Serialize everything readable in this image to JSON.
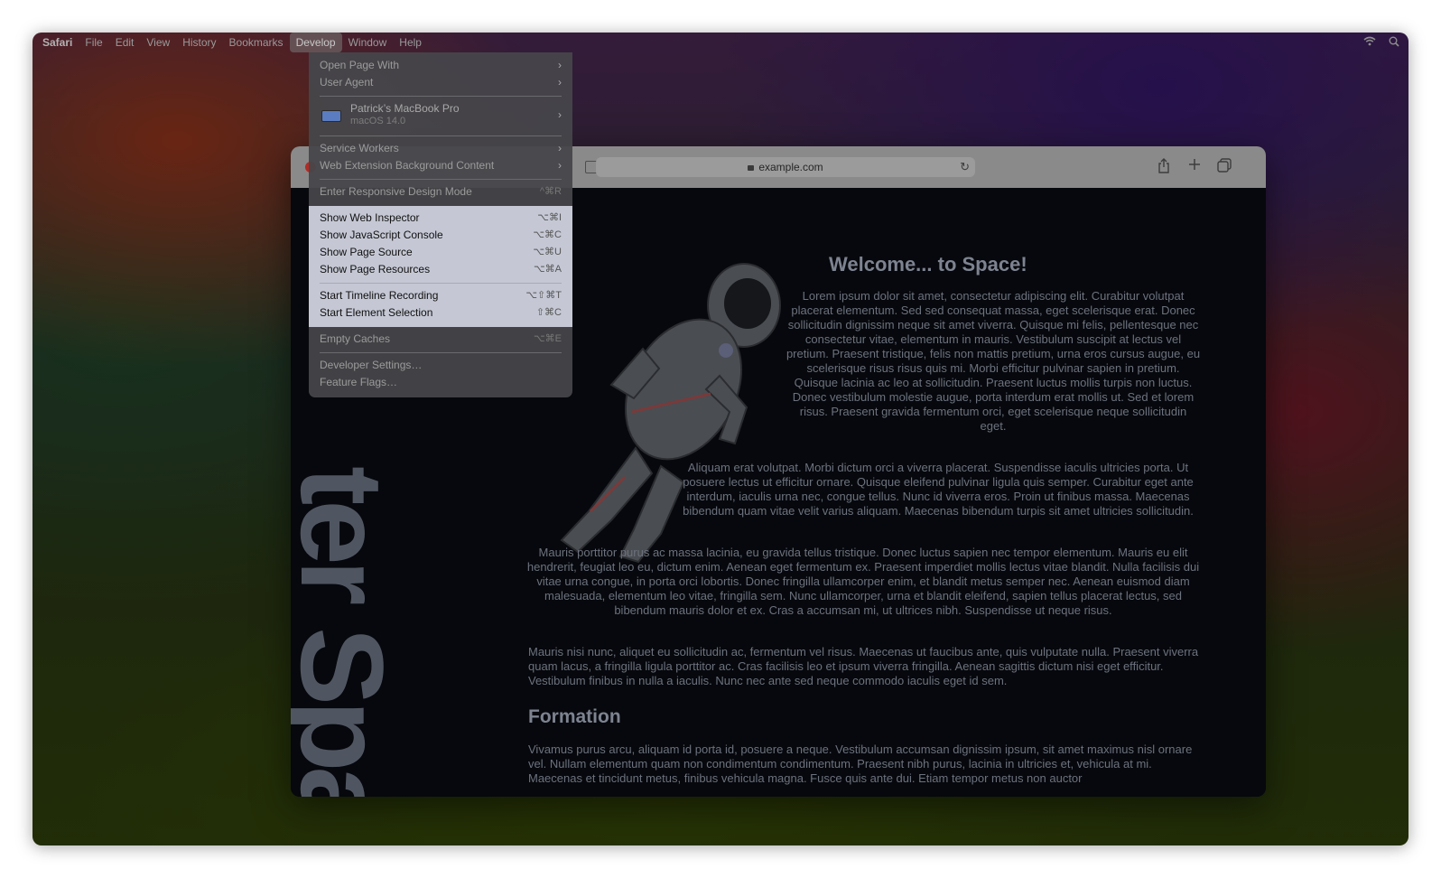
{
  "menubar": {
    "app": "Safari",
    "items": [
      "File",
      "Edit",
      "View",
      "History",
      "Bookmarks",
      "Develop",
      "Window",
      "Help"
    ],
    "active": "Develop",
    "status_icons": [
      "wifi-icon",
      "spotlight-search-icon"
    ]
  },
  "browser": {
    "url": "example.com",
    "toolbar_icons": [
      "sidebar-icon",
      "reload-icon",
      "share-icon",
      "new-tab-icon",
      "tab-overview-icon"
    ]
  },
  "page": {
    "vertical_title": "ter Spa",
    "heading": "Welcome... to Space!",
    "paragraphs": [
      "Lorem ipsum dolor sit amet, consectetur adipiscing elit. Curabitur volutpat placerat elementum. Sed sed consequat massa, eget scelerisque erat. Donec sollicitudin dignissim neque sit amet viverra. Quisque mi felis, pellentesque nec consectetur vitae, elementum in mauris. Vestibulum suscipit at lectus vel pretium. Praesent tristique, felis non mattis pretium, urna eros cursus augue, eu scelerisque risus risus quis mi. Morbi efficitur pulvinar sapien in pretium. Quisque lacinia ac leo at sollicitudin. Praesent luctus mollis turpis non luctus. Donec vestibulum molestie augue, porta interdum erat mollis ut. Sed et lorem risus. Praesent gravida fermentum orci, eget scelerisque neque sollicitudin eget.",
      "Aliquam erat volutpat. Morbi dictum orci a viverra placerat. Suspendisse iaculis ultricies porta. Ut posuere lectus ut efficitur ornare. Quisque eleifend pulvinar ligula quis semper. Curabitur eget ante interdum, iaculis urna nec, congue tellus. Nunc id viverra eros. Proin ut finibus massa. Maecenas bibendum quam vitae velit varius aliquam. Maecenas bibendum turpis sit amet ultricies sollicitudin.",
      "Mauris porttitor purus ac massa lacinia, eu gravida tellus tristique. Donec luctus sapien nec tempor elementum. Mauris eu elit hendrerit, feugiat leo eu, dictum enim. Aenean eget fermentum ex. Praesent imperdiet mollis lectus vitae blandit. Nulla facilisis dui vitae urna congue, in porta orci lobortis. Donec fringilla ullamcorper enim, et blandit metus semper nec. Aenean euismod diam malesuada, elementum leo vitae, fringilla sem. Nunc ullamcorper, urna et blandit eleifend, sapien tellus placerat lectus, sed bibendum mauris dolor et ex. Cras a accumsan mi, ut ultrices nibh. Suspendisse ut neque risus.",
      "Mauris nisi nunc, aliquet eu sollicitudin ac, fermentum vel risus. Maecenas ut faucibus ante, quis vulputate nulla. Praesent viverra quam lacus, a fringilla ligula porttitor ac. Cras facilisis leo et ipsum viverra fringilla. Aenean sagittis dictum nisi eget efficitur. Vestibulum finibus in nulla a iaculis. Nunc nec ante sed neque commodo iaculis eget id sem."
    ],
    "subheading": "Formation",
    "last_paragraph": "Vivamus purus arcu, aliquam id porta id, posuere a neque. Vestibulum accumsan dignissim ipsum, sit amet maximus nisl ornare vel. Nullam elementum quam non condimentum condimentum. Praesent nibh purus, lacinia in ultricies et, vehicula at mi. Maecenas et tincidunt metus, finibus vehicula magna. Fusce quis ante dui. Etiam tempor metus non auctor"
  },
  "develop_menu": {
    "open_page_with": "Open Page With",
    "user_agent": "User Agent",
    "device_name": "Patrick’s MacBook Pro",
    "device_os": "macOS 14.0",
    "service_workers": "Service Workers",
    "web_extension": "Web Extension Background Content",
    "responsive": {
      "label": "Enter Responsive Design Mode",
      "shortcut": "^⌘R"
    },
    "web_inspector": {
      "label": "Show Web Inspector",
      "shortcut": "⌥⌘I"
    },
    "js_console": {
      "label": "Show JavaScript Console",
      "shortcut": "⌥⌘C"
    },
    "page_source": {
      "label": "Show Page Source",
      "shortcut": "⌥⌘U"
    },
    "page_resources": {
      "label": "Show Page Resources",
      "shortcut": "⌥⌘A"
    },
    "timeline": {
      "label": "Start Timeline Recording",
      "shortcut": "⌥⇧⌘T"
    },
    "element_selection": {
      "label": "Start Element Selection",
      "shortcut": "⇧⌘C"
    },
    "empty_caches": {
      "label": "Empty Caches",
      "shortcut": "⌥⌘E"
    },
    "developer_settings": "Developer Settings…",
    "feature_flags": "Feature Flags…"
  }
}
